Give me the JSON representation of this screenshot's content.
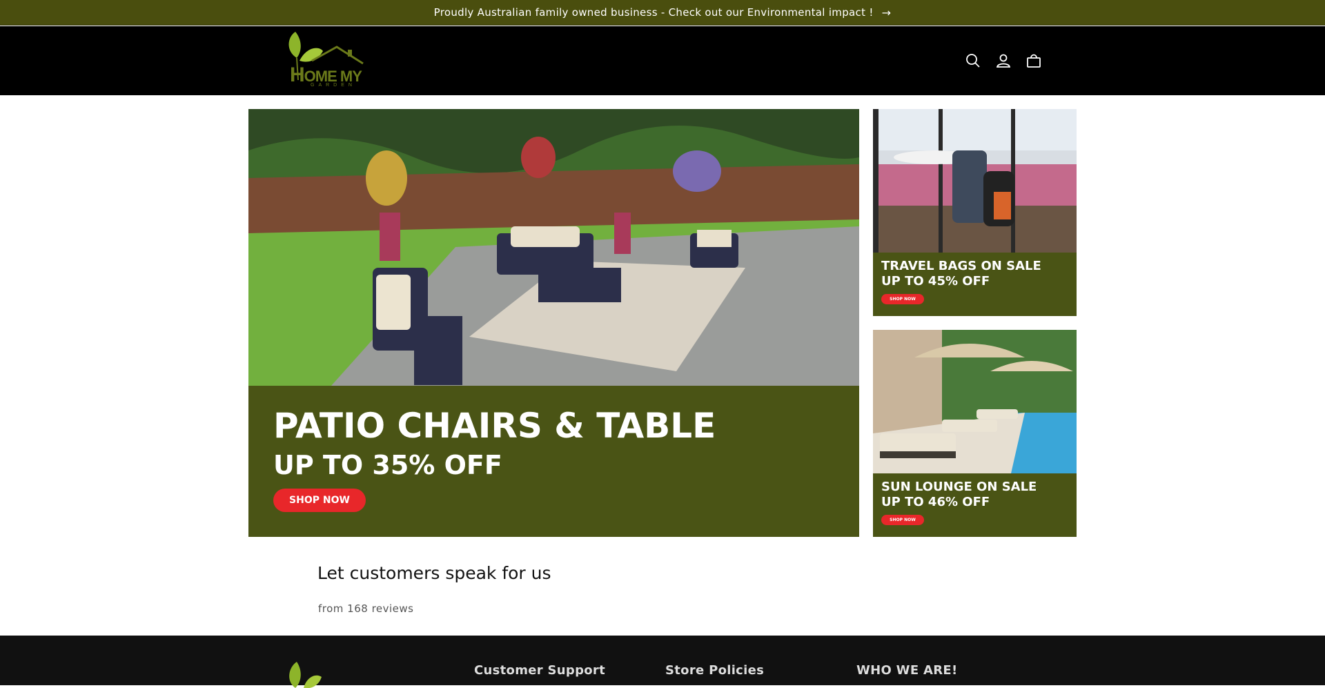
{
  "announcement": {
    "text": "Proudly Australian family owned business - Check out our Environmental impact !",
    "arrow_icon": "arrow-right-icon"
  },
  "header": {
    "logo_text_big": "H",
    "logo_text": "OME MY",
    "logo_sub": "GARDEN",
    "icons": [
      "search-icon",
      "account-icon",
      "cart-icon"
    ]
  },
  "hero": {
    "title": "PATIO CHAIRS & TABLE",
    "subtitle": "UP TO 35% OFF",
    "button": "SHOP NOW"
  },
  "side_banners": [
    {
      "title": "TRAVEL BAGS ON SALE",
      "subtitle": "UP TO 45% OFF",
      "button": "SHOP NOW"
    },
    {
      "title": "SUN LOUNGE ON SALE",
      "subtitle": "UP TO 46% OFF",
      "button": "SHOP NOW"
    }
  ],
  "reviews": {
    "title": "Let customers speak for us",
    "count": "from 168 reviews"
  },
  "footer": {
    "headings": [
      "Customer Support",
      "Store Policies",
      "WHO WE ARE!"
    ]
  },
  "colors": {
    "announcement_bg": "#4a4e0e",
    "banner_bg": "#4a5415",
    "accent_red": "#e8272a",
    "header_bg": "#000000"
  }
}
